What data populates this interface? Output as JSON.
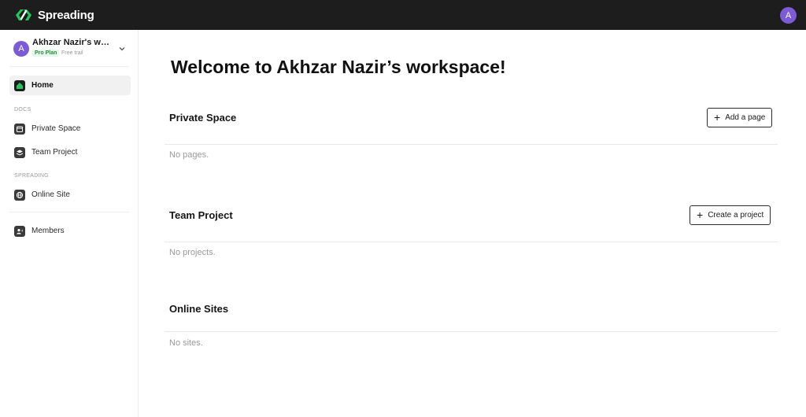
{
  "app": {
    "logo_text": "Spreading",
    "brand_color": "#22c55e",
    "user_initial": "A"
  },
  "sidebar": {
    "workspace": {
      "initial": "A",
      "name": "Akhzar Nazir's work...",
      "plan_badge": "Pro Plan",
      "plan_note": "Free trail"
    },
    "home_label": "Home",
    "docs_section": "DOCS",
    "docs_items": [
      {
        "label": "Private Space",
        "icon": "calendar-icon"
      },
      {
        "label": "Team Project",
        "icon": "layers-icon"
      }
    ],
    "spreading_section": "SPREADING",
    "spreading_items": [
      {
        "label": "Online Site",
        "icon": "globe-icon"
      }
    ],
    "members_label": "Members"
  },
  "main": {
    "welcome": "Welcome to Akhzar Nazir’s workspace!",
    "sections": [
      {
        "title": "Private Space",
        "button": "Add a page",
        "empty": "No pages."
      },
      {
        "title": "Team Project",
        "button": "Create a project",
        "empty": "No projects."
      },
      {
        "title": "Online Sites",
        "empty": "No sites."
      }
    ]
  }
}
